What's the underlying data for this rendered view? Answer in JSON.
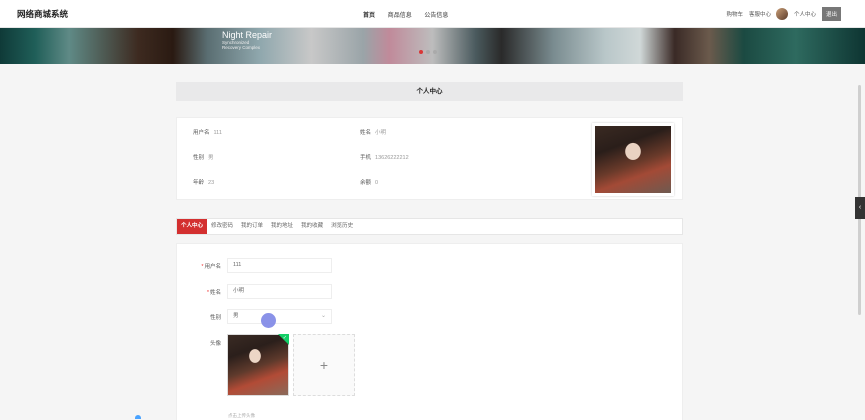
{
  "header": {
    "logo": "网络商城系统",
    "nav": [
      "首页",
      "商品信息",
      "公告信息"
    ],
    "right": {
      "cart": "购物车",
      "service": "客服中心",
      "profile": "个人中心",
      "logout": "退出"
    }
  },
  "banner": {
    "title": "Night Repair",
    "subtitle1": "Synchronized",
    "subtitle2": "Recovery Complex"
  },
  "page_title": "个人中心",
  "profile": {
    "username_label": "用户名",
    "username": "111",
    "name_label": "姓名",
    "name": "小明",
    "gender_label": "性别",
    "gender": "男",
    "phone_label": "手机",
    "phone": "13626222212",
    "age_label": "年龄",
    "age": "23",
    "balance_label": "余额",
    "balance": "0"
  },
  "tabs": [
    "个人中心",
    "修改密码",
    "我的订单",
    "我的地址",
    "我的收藏",
    "浏览历史"
  ],
  "form": {
    "username_label": "用户名",
    "username_value": "111",
    "name_label": "姓名",
    "name_value": "小明",
    "gender_label": "性别",
    "gender_value": "男",
    "avatar_label": "头像",
    "upload_plus": "+",
    "hint": "点击上传头像"
  },
  "colors": {
    "accent": "#d32f2f",
    "success": "#13ce66",
    "cursor": "#7d86e6"
  }
}
